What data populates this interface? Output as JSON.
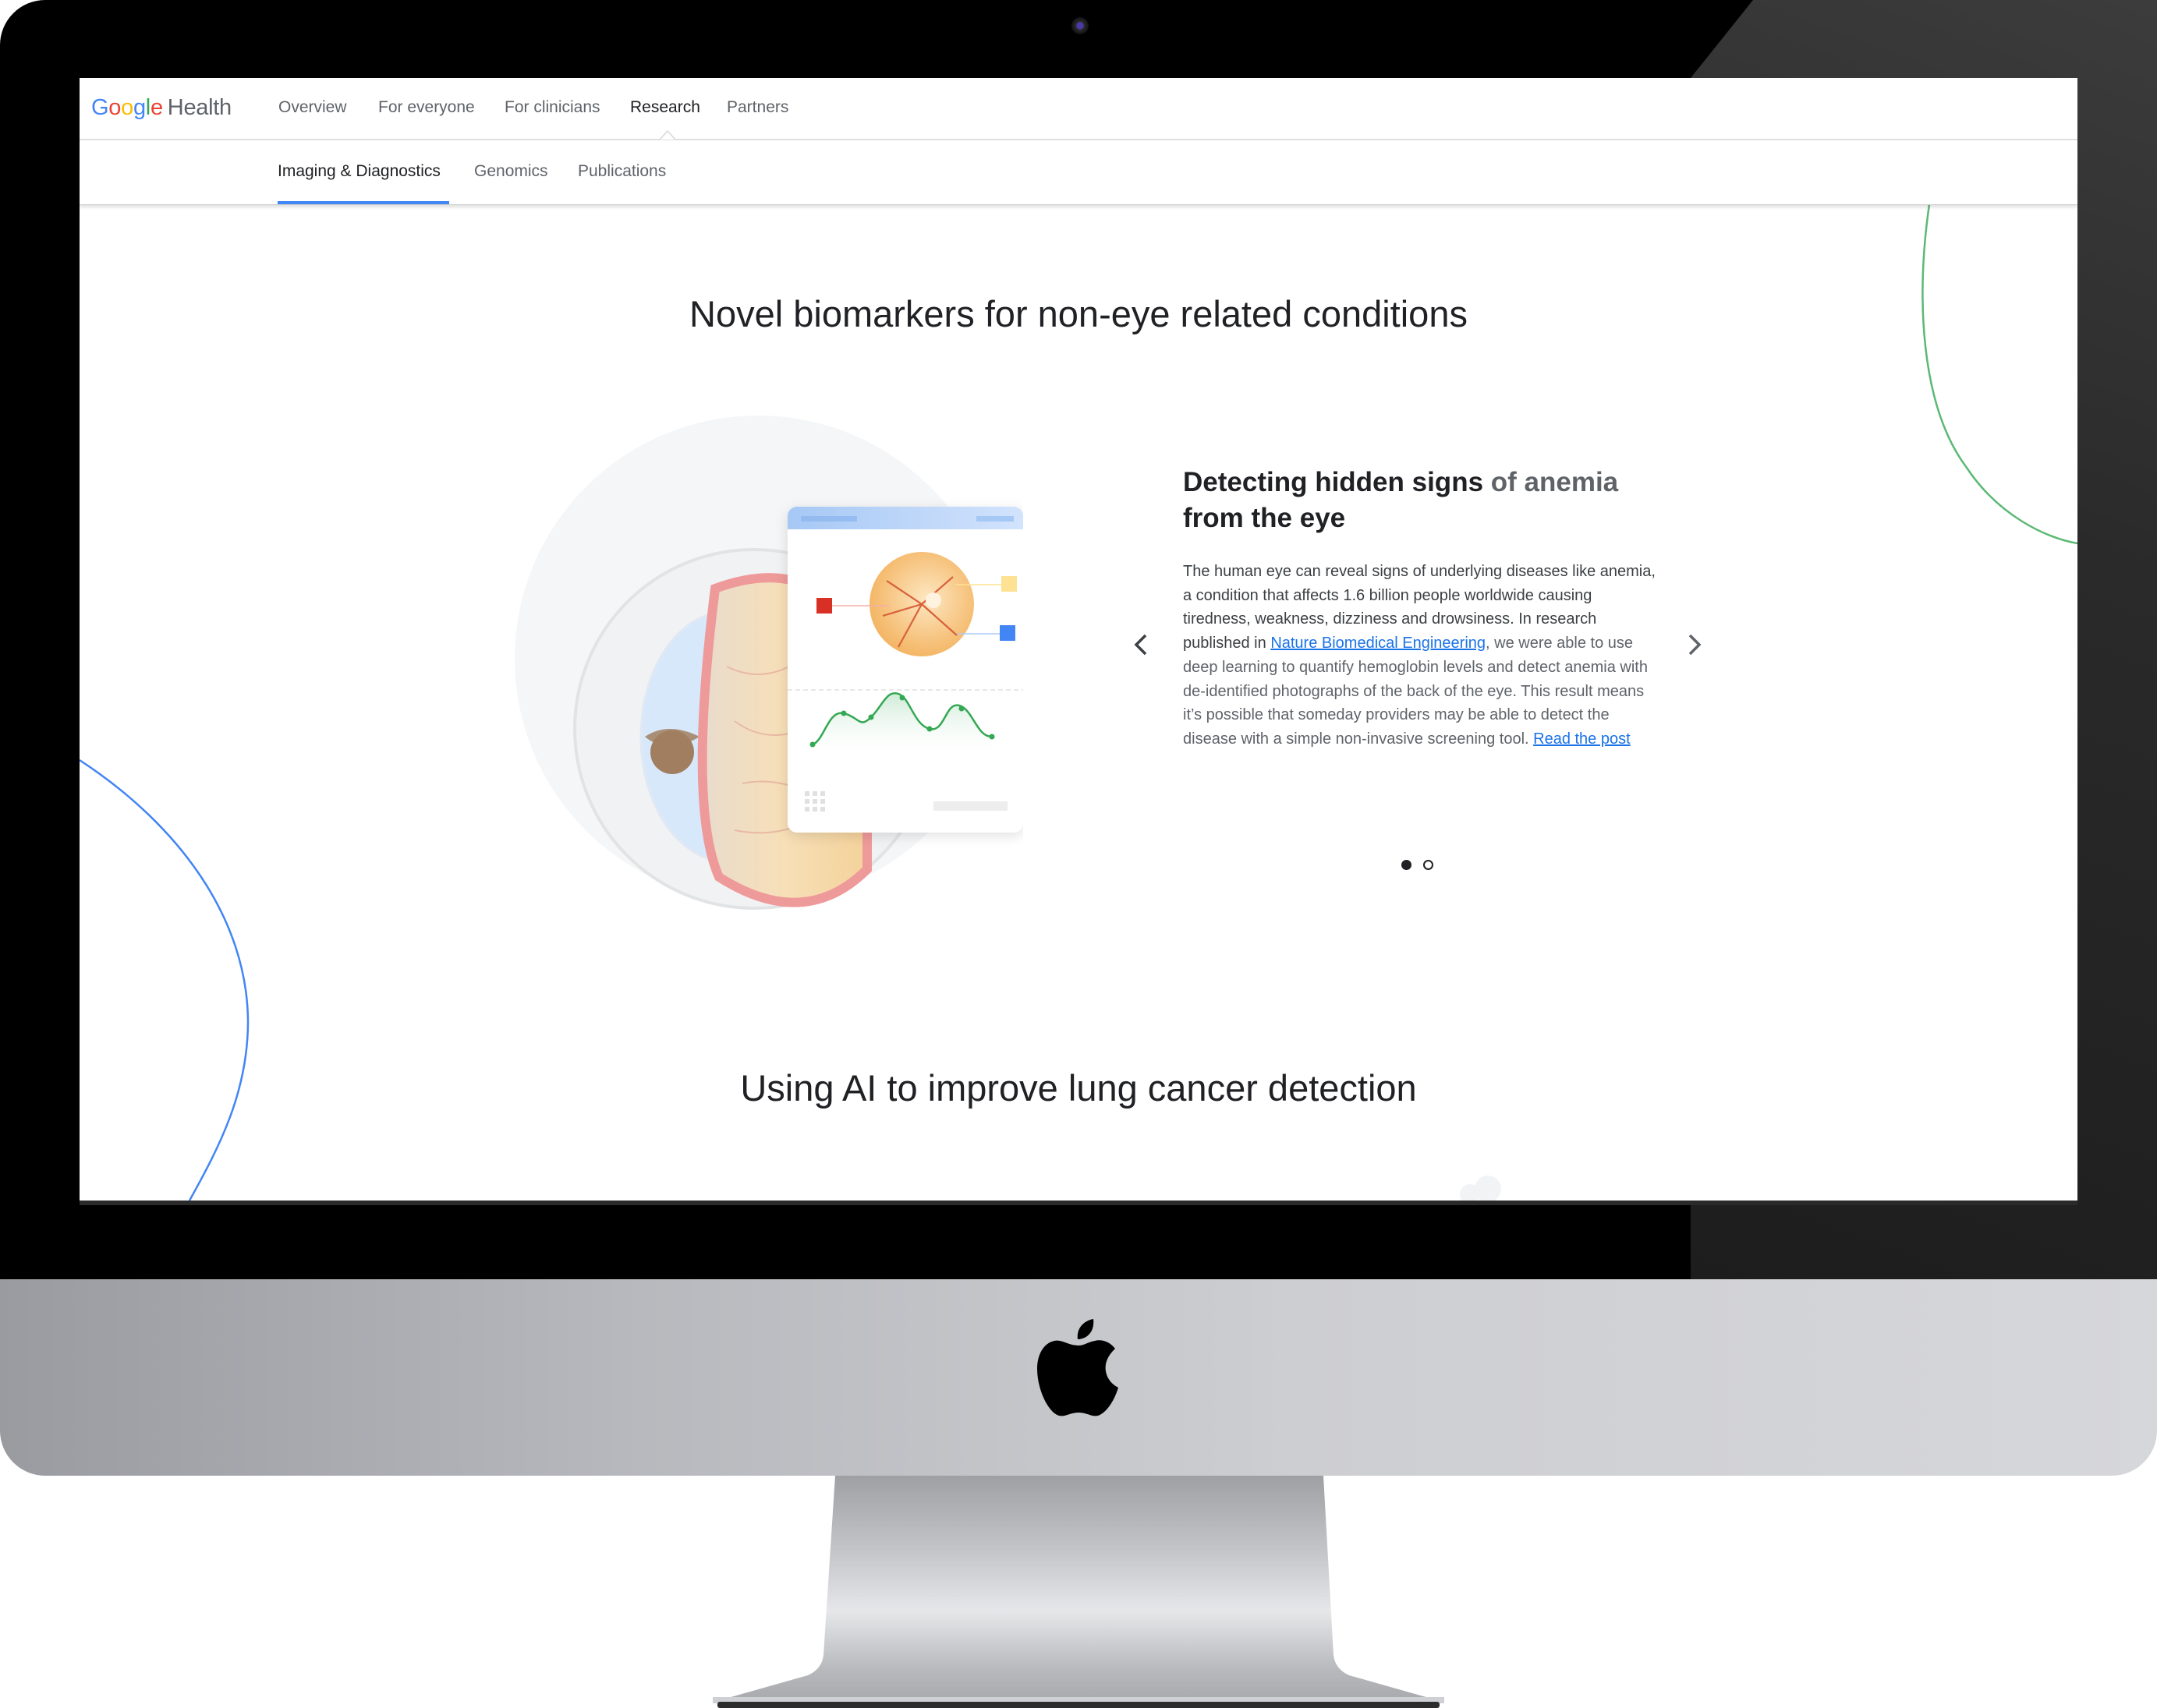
{
  "nav": {
    "logo": {
      "parts": [
        "G",
        "o",
        "o",
        "g",
        "l",
        "e"
      ],
      "product": "Health"
    },
    "items": [
      {
        "label": "Overview",
        "active": false
      },
      {
        "label": "For everyone",
        "active": false
      },
      {
        "label": "For clinicians",
        "active": false
      },
      {
        "label": "Research",
        "active": true
      },
      {
        "label": "Partners",
        "active": false
      }
    ],
    "sub_items": [
      {
        "label": "Imaging & Diagnostics",
        "active": true
      },
      {
        "label": "Genomics",
        "active": false
      },
      {
        "label": "Publications",
        "active": false
      }
    ]
  },
  "section1": {
    "title": "Novel biomarkers for non-eye related conditions",
    "carousel": {
      "current_slide": 1,
      "total_slides": 2,
      "prev_icon": "chevron-left-icon",
      "next_icon": "chevron-right-icon",
      "slide": {
        "heading_dark": "Detecting hidden signs",
        "heading_faded": " of anemia",
        "heading_line2": "from the eye",
        "body_1": "The human eye can reveal signs of underlying diseases like anemia, a condition that affects 1.6 billion people worldwide causing tiredness, weakness, dizziness and drowsiness. In research published in ",
        "link_1": "Nature Biomedical Engineering",
        "body_2": ", we were able to use deep learning to quantify hemoglobin levels and detect anemia with de-identified photographs of the back of the eye. This result means it’s possible that someday providers may be able to detect the disease with a simple non-invasive screening tool. ",
        "link_2": "Read the post",
        "illustration": "eye-anatomy-with-retina-scan-card"
      }
    }
  },
  "section2": {
    "title": "Using AI to improve lung cancer detection"
  },
  "colors": {
    "accent_blue": "#4285f4",
    "link_blue": "#1a73e8",
    "google_red": "#ea4335",
    "google_yellow": "#fbbc05",
    "google_green": "#34a853",
    "text_dark": "#202124",
    "text_muted": "#5f6368"
  },
  "device": {
    "type": "desktop-monitor-mockup",
    "logo": "apple-logo"
  }
}
